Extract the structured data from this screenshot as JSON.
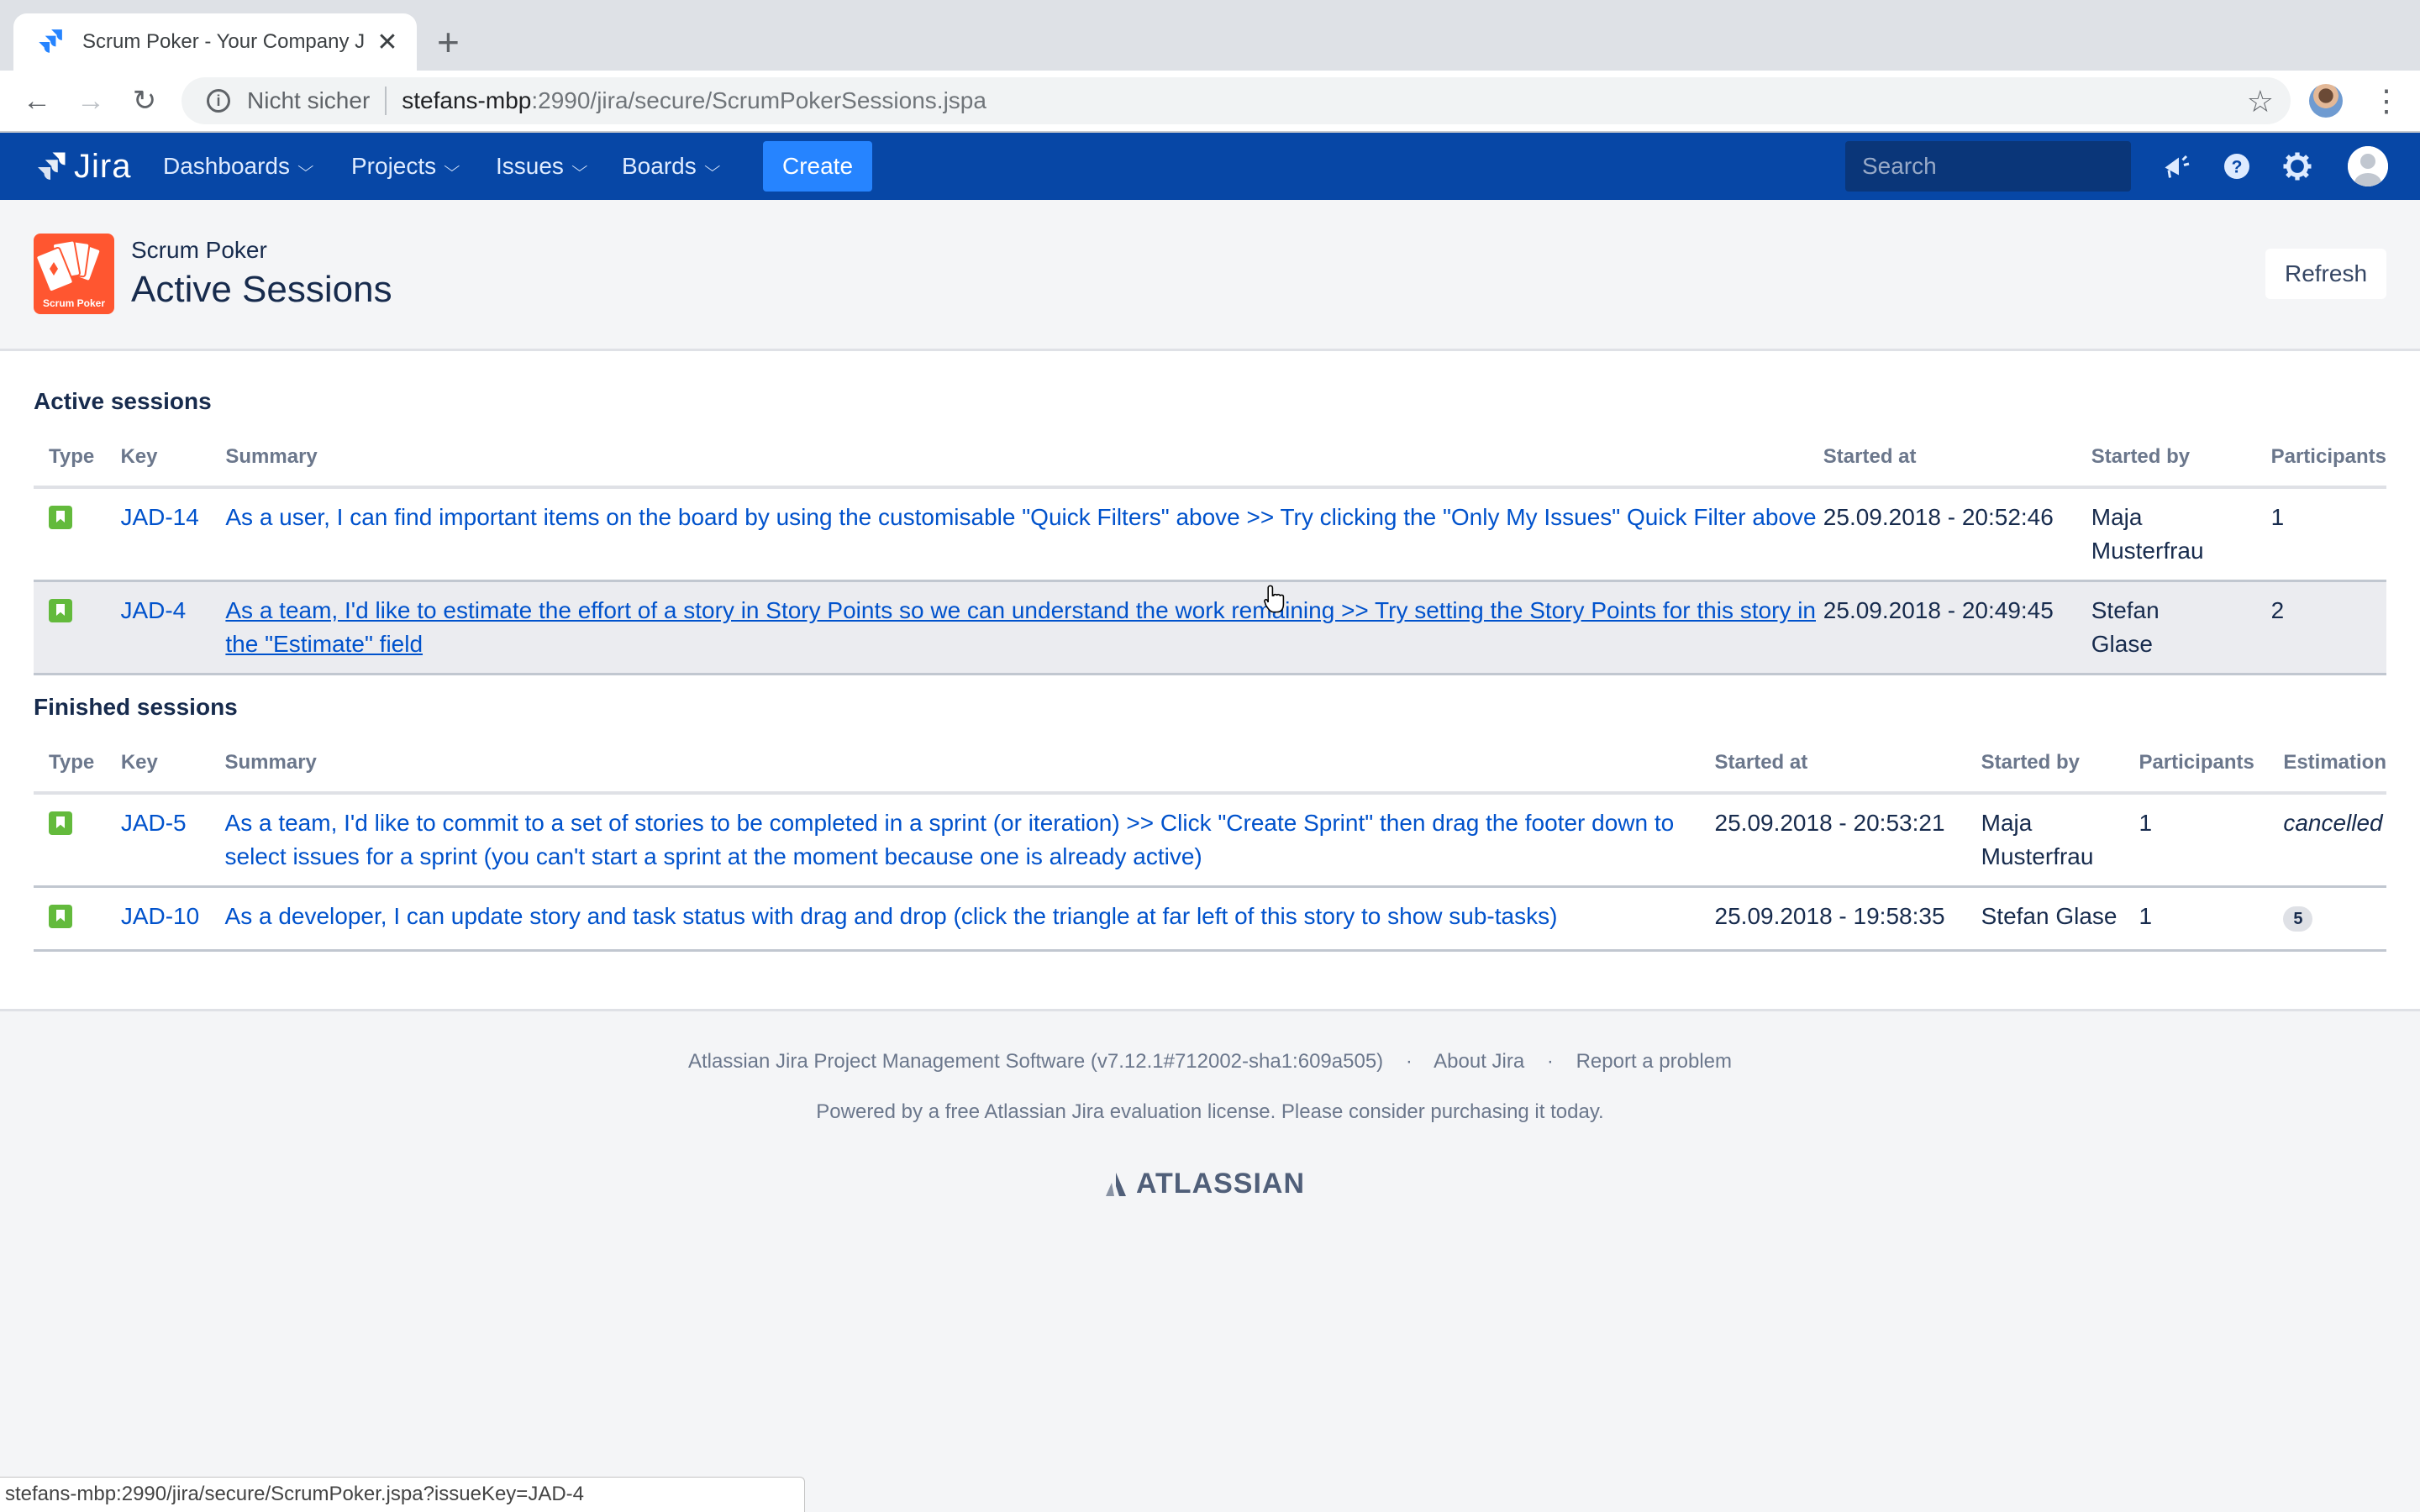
{
  "browser": {
    "tab_title": "Scrum Poker - Your Company J",
    "tab_close": "✕",
    "new_tab": "+",
    "back": "←",
    "forward": "→",
    "reload": "↻",
    "security_label": "Nicht sicher",
    "url_host": "stefans-mbp",
    "url_path": ":2990/jira/secure/ScrumPokerSessions.jspa",
    "bookmark_star": "☆",
    "menu": "⋮",
    "status_url": "stefans-mbp:2990/jira/secure/ScrumPoker.jspa?issueKey=JAD-4"
  },
  "header": {
    "logo_text": "Jira",
    "nav": [
      {
        "label": "Dashboards"
      },
      {
        "label": "Projects"
      },
      {
        "label": "Issues"
      },
      {
        "label": "Boards"
      }
    ],
    "chevron": "⌄",
    "create_label": "Create",
    "search_placeholder": "Search",
    "brand_color": "#0747a6",
    "create_color": "#2684ff"
  },
  "page": {
    "app_name": "Scrum Poker",
    "logo_caption": "Scrum Poker",
    "title": "Active Sessions",
    "refresh_label": "Refresh"
  },
  "active": {
    "title": "Active sessions",
    "columns": [
      "Type",
      "Key",
      "Summary",
      "Started at",
      "Started by",
      "Participants"
    ],
    "rows": [
      {
        "type": "story-icon",
        "key": "JAD-14",
        "summary": "As a user, I can find important items on the board by using the customisable \"Quick Filters\" above >> Try clicking the \"Only My Issues\" Quick Filter above",
        "started_at": "25.09.2018 - 20:52:46",
        "started_by": "Maja Musterfrau",
        "participants": "1"
      },
      {
        "type": "story-icon",
        "key": "JAD-4",
        "summary": "As a team, I'd like to estimate the effort of a story in Story Points so we can understand the work remaining >> Try setting the Story Points for this story in the \"Estimate\" field",
        "started_at": "25.09.2018 - 20:49:45",
        "started_by": "Stefan Glase",
        "participants": "2"
      }
    ]
  },
  "finished": {
    "title": "Finished sessions",
    "columns": [
      "Type",
      "Key",
      "Summary",
      "Started at",
      "Started by",
      "Participants",
      "Estimation"
    ],
    "rows": [
      {
        "type": "story-icon",
        "key": "JAD-5",
        "summary": "As a team, I'd like to commit to a set of stories to be completed in a sprint (or iteration) >> Click \"Create Sprint\" then drag the footer down to select issues for a sprint (you can't start a sprint at the moment because one is already active)",
        "started_at": "25.09.2018 - 20:53:21",
        "started_by": "Maja Musterfrau",
        "participants": "1",
        "estimation": "cancelled"
      },
      {
        "type": "story-icon",
        "key": "JAD-10",
        "summary": "As a developer, I can update story and task status with drag and drop (click the triangle at far left of this story to show sub-tasks)",
        "started_at": "25.09.2018 - 19:58:35",
        "started_by": "Stefan Glase",
        "participants": "1",
        "estimation": "5"
      }
    ]
  },
  "footer": {
    "version": "Atlassian Jira Project Management Software (v7.12.1#712002-sha1:609a505)",
    "separator": "·",
    "about": "About Jira",
    "report": "Report a problem",
    "license": "Powered by a free Atlassian Jira evaluation license. Please consider purchasing it today.",
    "atlassian": "ATLASSIAN"
  },
  "colors": {
    "link": "#0052cc",
    "story": "#63ba3c",
    "app_logo": "#ff5630"
  }
}
